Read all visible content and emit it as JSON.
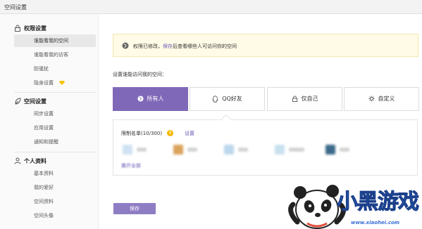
{
  "window": {
    "title": "空间设置"
  },
  "sidebar": {
    "sections": [
      {
        "title": "权限设置",
        "icon": "lock-icon",
        "items": [
          "谁能看我的空间",
          "谁能看我的访客",
          "防骚扰",
          "隐身设置"
        ]
      },
      {
        "title": "空间设置",
        "icon": "leaf-icon",
        "items": [
          "同步设置",
          "应用设置",
          "通知和提醒"
        ]
      },
      {
        "title": "个人资料",
        "icon": "person-icon",
        "items": [
          "基本资料",
          "我的爱好",
          "空间资料",
          "空间头像"
        ]
      }
    ],
    "active_item": "谁能看我的空间"
  },
  "notice": {
    "prefix": "权限已修改，",
    "link": "保存",
    "suffix": "后查看哪些人可访问你的空间"
  },
  "access": {
    "prompt": "设置谁能访问我的空间：",
    "options": [
      "所有人",
      "QQ好友",
      "仅自己",
      "自定义"
    ],
    "selected": "所有人"
  },
  "blacklist": {
    "label": "限制名单(10/300)",
    "set_link": "设置",
    "expand": "展开全部"
  },
  "save_label": "保存",
  "watermark": {
    "text": "小黑游戏",
    "url": "www.xiaohei.com"
  },
  "colors": {
    "accent": "#8068b8",
    "link": "#6b5bb5",
    "notice_bg": "#fffbe6"
  }
}
